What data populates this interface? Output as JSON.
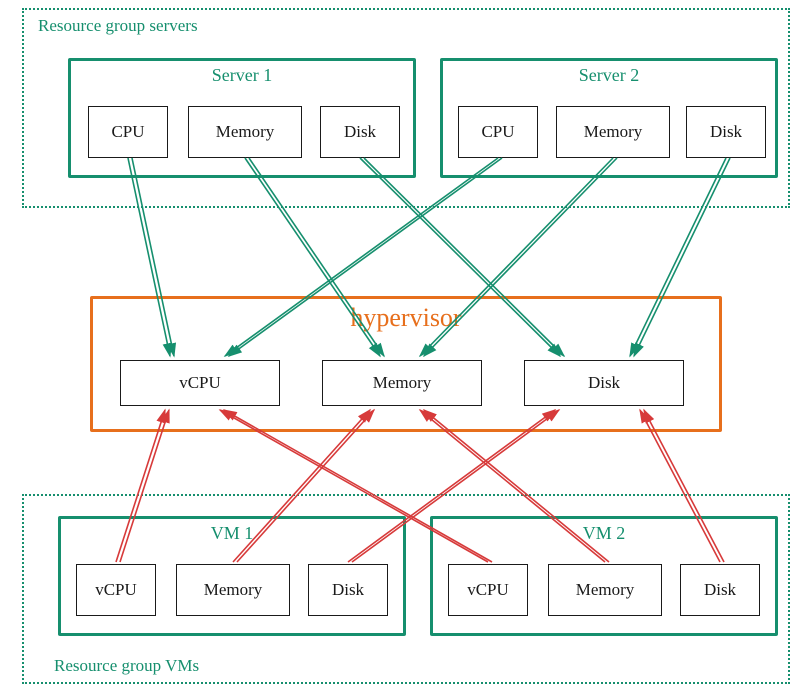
{
  "groups": {
    "top_label": "Resource group servers",
    "bottom_label": "Resource group VMs"
  },
  "servers": {
    "s1": {
      "title": "Server 1",
      "cpu": "CPU",
      "memory": "Memory",
      "disk": "Disk"
    },
    "s2": {
      "title": "Server 2",
      "cpu": "CPU",
      "memory": "Memory",
      "disk": "Disk"
    }
  },
  "hypervisor": {
    "title": "hypervisor",
    "vcpu": "vCPU",
    "memory": "Memory",
    "disk": "Disk"
  },
  "vms": {
    "v1": {
      "title": "VM 1",
      "vcpu": "vCPU",
      "memory": "Memory",
      "disk": "Disk"
    },
    "v2": {
      "title": "VM 2",
      "vcpu": "vCPU",
      "memory": "Memory",
      "disk": "Disk"
    }
  },
  "colors": {
    "green": "#168f6e",
    "orange": "#e76f1c",
    "red": "#d73a3a",
    "black": "#1a1a1a"
  },
  "chart_data": {
    "type": "diagram",
    "title": "Hypervisor resource aggregation",
    "nodes": [
      {
        "id": "rg_servers",
        "label": "Resource group servers",
        "type": "group"
      },
      {
        "id": "server1",
        "label": "Server 1",
        "parent": "rg_servers",
        "type": "server"
      },
      {
        "id": "server1.cpu",
        "label": "CPU",
        "parent": "server1",
        "type": "resource"
      },
      {
        "id": "server1.memory",
        "label": "Memory",
        "parent": "server1",
        "type": "resource"
      },
      {
        "id": "server1.disk",
        "label": "Disk",
        "parent": "server1",
        "type": "resource"
      },
      {
        "id": "server2",
        "label": "Server 2",
        "parent": "rg_servers",
        "type": "server"
      },
      {
        "id": "server2.cpu",
        "label": "CPU",
        "parent": "server2",
        "type": "resource"
      },
      {
        "id": "server2.memory",
        "label": "Memory",
        "parent": "server2",
        "type": "resource"
      },
      {
        "id": "server2.disk",
        "label": "Disk",
        "parent": "server2",
        "type": "resource"
      },
      {
        "id": "hypervisor",
        "label": "hypervisor",
        "type": "hypervisor"
      },
      {
        "id": "hypervisor.vcpu",
        "label": "vCPU",
        "parent": "hypervisor",
        "type": "pool"
      },
      {
        "id": "hypervisor.memory",
        "label": "Memory",
        "parent": "hypervisor",
        "type": "pool"
      },
      {
        "id": "hypervisor.disk",
        "label": "Disk",
        "parent": "hypervisor",
        "type": "pool"
      },
      {
        "id": "rg_vms",
        "label": "Resource group VMs",
        "type": "group"
      },
      {
        "id": "vm1",
        "label": "VM 1",
        "parent": "rg_vms",
        "type": "vm"
      },
      {
        "id": "vm1.vcpu",
        "label": "vCPU",
        "parent": "vm1",
        "type": "resource"
      },
      {
        "id": "vm1.memory",
        "label": "Memory",
        "parent": "vm1",
        "type": "resource"
      },
      {
        "id": "vm1.disk",
        "label": "Disk",
        "parent": "vm1",
        "type": "resource"
      },
      {
        "id": "vm2",
        "label": "VM 2",
        "parent": "rg_vms",
        "type": "vm"
      },
      {
        "id": "vm2.vcpu",
        "label": "vCPU",
        "parent": "vm2",
        "type": "resource"
      },
      {
        "id": "vm2.memory",
        "label": "Memory",
        "parent": "vm2",
        "type": "resource"
      },
      {
        "id": "vm2.disk",
        "label": "Disk",
        "parent": "vm2",
        "type": "resource"
      }
    ],
    "edges": [
      {
        "from": "server1.cpu",
        "to": "hypervisor.vcpu",
        "color": "green"
      },
      {
        "from": "server1.memory",
        "to": "hypervisor.memory",
        "color": "green"
      },
      {
        "from": "server1.disk",
        "to": "hypervisor.disk",
        "color": "green"
      },
      {
        "from": "server2.cpu",
        "to": "hypervisor.vcpu",
        "color": "green"
      },
      {
        "from": "server2.memory",
        "to": "hypervisor.memory",
        "color": "green"
      },
      {
        "from": "server2.disk",
        "to": "hypervisor.disk",
        "color": "green"
      },
      {
        "from": "vm1.vcpu",
        "to": "hypervisor.vcpu",
        "color": "red"
      },
      {
        "from": "vm1.memory",
        "to": "hypervisor.memory",
        "color": "red"
      },
      {
        "from": "vm1.disk",
        "to": "hypervisor.disk",
        "color": "red"
      },
      {
        "from": "vm2.vcpu",
        "to": "hypervisor.vcpu",
        "color": "red"
      },
      {
        "from": "vm2.memory",
        "to": "hypervisor.memory",
        "color": "red"
      },
      {
        "from": "vm2.disk",
        "to": "hypervisor.disk",
        "color": "red"
      }
    ]
  }
}
